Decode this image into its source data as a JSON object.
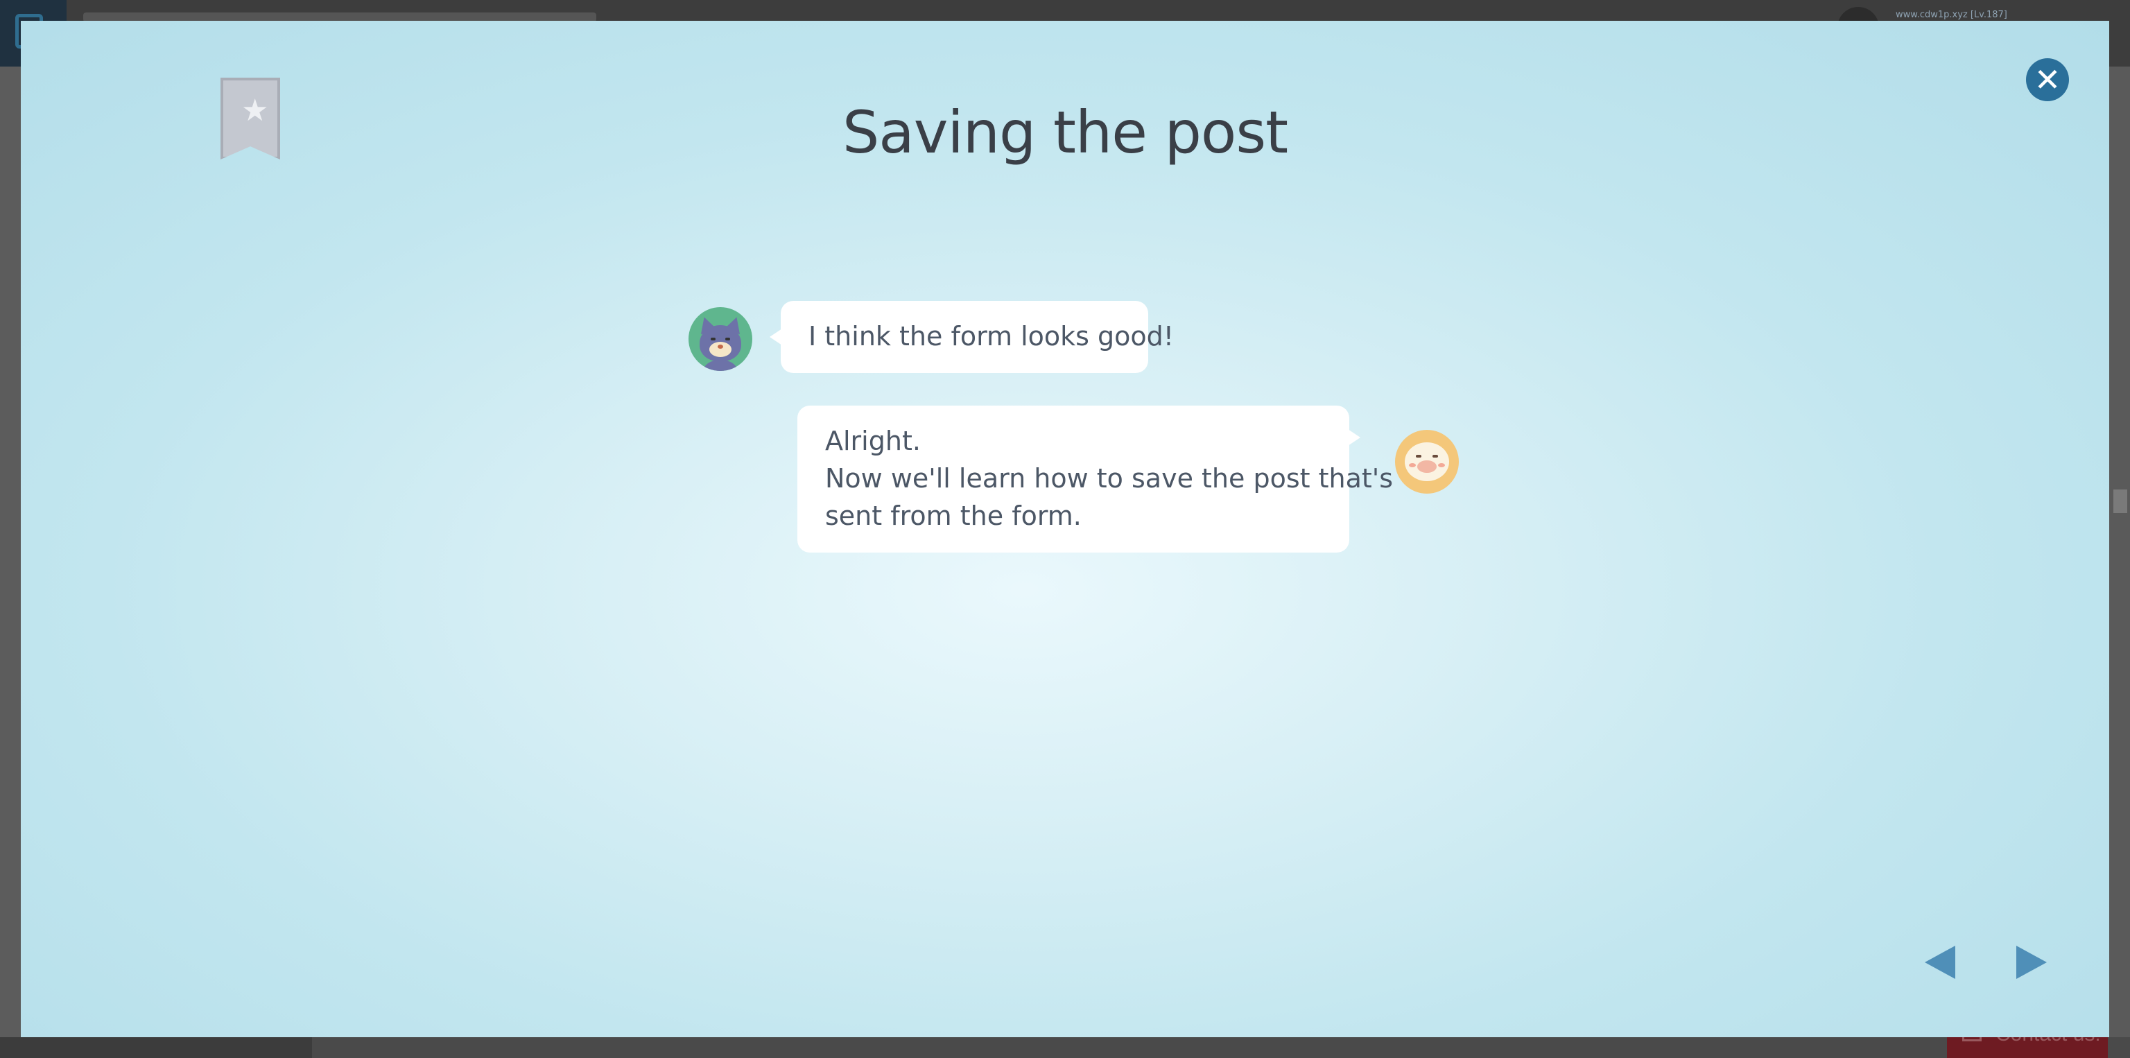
{
  "background": {
    "user_text": "www.cdw1p.xyz [Lv.187]",
    "contact_label": "Contact us!"
  },
  "lesson": {
    "title": "Saving the post",
    "bookmark_icon": "star-bookmark-icon",
    "close_icon": "close-icon"
  },
  "chat": [
    {
      "speaker": "cat",
      "side": "left",
      "lines": [
        "I think the form looks good!"
      ]
    },
    {
      "speaker": "pig",
      "side": "right",
      "lines": [
        "Alright.",
        "Now we'll learn how to save the post that's",
        "sent from the form."
      ]
    }
  ],
  "navigation": {
    "prev_icon": "triangle-left-icon",
    "next_icon": "triangle-right-icon"
  },
  "colors": {
    "accent": "#2a6f9a",
    "nav": "#4f8fb8",
    "title_text": "#3a3f47",
    "bubble_text": "#4c5766"
  }
}
